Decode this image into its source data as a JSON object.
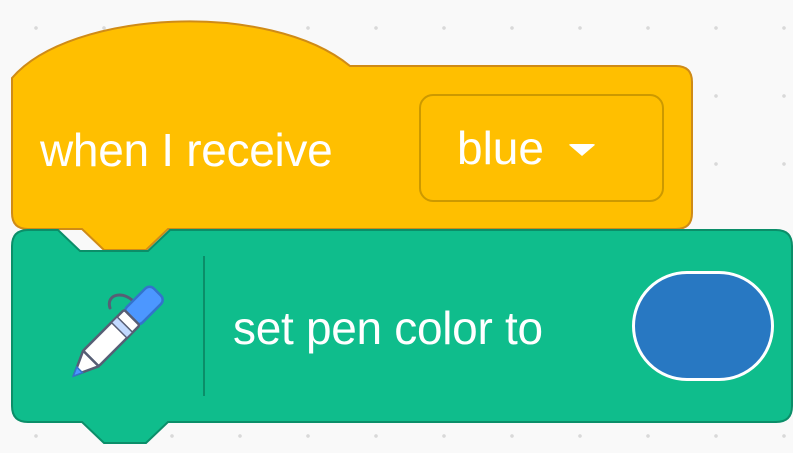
{
  "hat_block": {
    "label": "when I receive",
    "dropdown_value": "blue",
    "color": "#ffbf00",
    "border_color": "#cf8b17"
  },
  "pen_block": {
    "label": "set pen color to",
    "icon": "pen-icon",
    "color": "#0fbd8c",
    "border_color": "#0b8e69",
    "swatch_color": "#2878c2"
  }
}
